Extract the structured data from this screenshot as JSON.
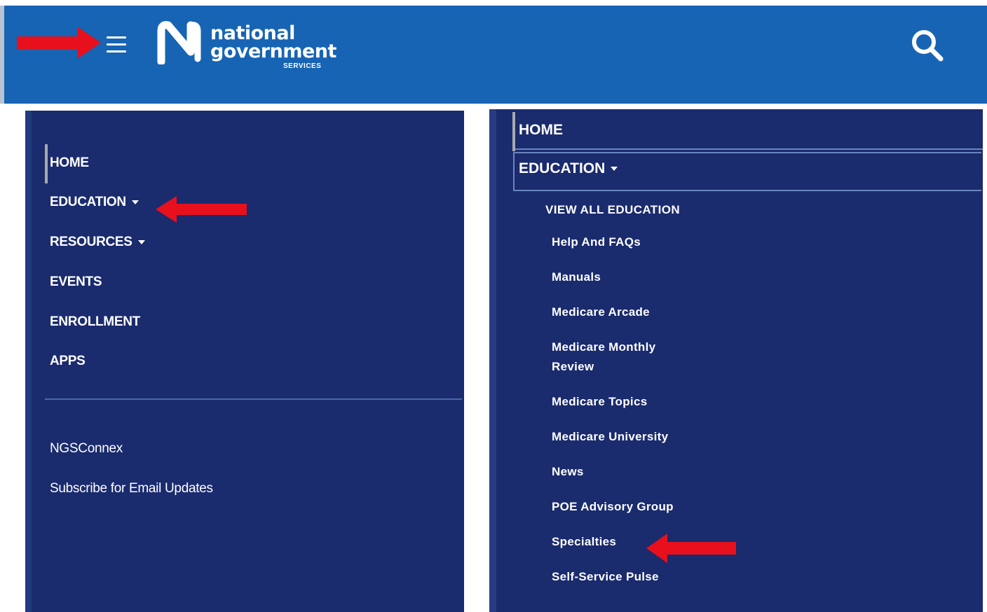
{
  "header": {
    "logo": {
      "line1": "national",
      "line2": "government",
      "line3": "SERVICES"
    },
    "colors": {
      "header_bg": "#1764b4",
      "panel_bg": "#1a2b6e",
      "arrow": "#e8101c"
    },
    "icons": {
      "menu": "hamburger-menu-icon",
      "search": "search-icon",
      "logo": "ngs-logo-mark"
    }
  },
  "left_menu": {
    "items": [
      {
        "label": "HOME",
        "has_dropdown": false,
        "active": true
      },
      {
        "label": "EDUCATION",
        "has_dropdown": true
      },
      {
        "label": "RESOURCES",
        "has_dropdown": true
      },
      {
        "label": "EVENTS",
        "has_dropdown": false
      },
      {
        "label": "ENROLLMENT",
        "has_dropdown": false
      },
      {
        "label": "APPS",
        "has_dropdown": false
      }
    ],
    "links": [
      {
        "label": "NGSConnex"
      },
      {
        "label": "Subscribe for Email Updates"
      }
    ]
  },
  "right_menu": {
    "home": "HOME",
    "education": "EDUCATION",
    "view_all": "VIEW ALL EDUCATION",
    "submenu": [
      "Help And FAQs",
      "Manuals",
      "Medicare Arcade",
      "Medicare Monthly Review",
      "Medicare Topics",
      "Medicare University",
      "News",
      "POE Advisory Group",
      "Specialties",
      "Self-Service Pulse"
    ]
  }
}
